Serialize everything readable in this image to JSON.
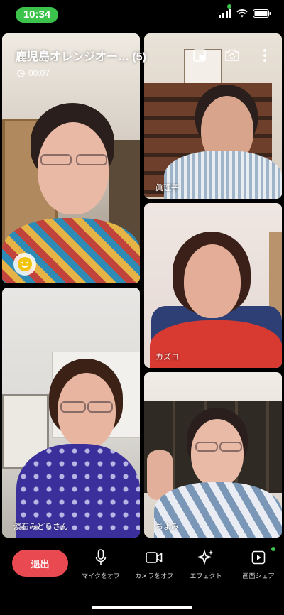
{
  "status_bar": {
    "time": "10:34"
  },
  "call": {
    "title": "鹿児島オレンジオー… (5)",
    "elapsed": "00:07"
  },
  "participants": [
    {
      "name": ""
    },
    {
      "name": "眞理子"
    },
    {
      "name": "カズコ"
    },
    {
      "name": "濱石みどりさん"
    },
    {
      "name": "ちよみ"
    }
  ],
  "toolbar": {
    "leave_label": "退出",
    "mic_label": "マイクをオフ",
    "camera_label": "カメラをオフ",
    "effect_label": "エフェクト",
    "share_label": "画面シェア"
  },
  "colors": {
    "accent_green": "#3cc34c",
    "leave_red": "#e94a52"
  },
  "icons": [
    "pip-icon",
    "flip-camera-icon",
    "more-icon",
    "clock-icon",
    "emoji-icon",
    "mic-icon",
    "camera-icon",
    "sparkle-icon",
    "screen-share-icon"
  ]
}
